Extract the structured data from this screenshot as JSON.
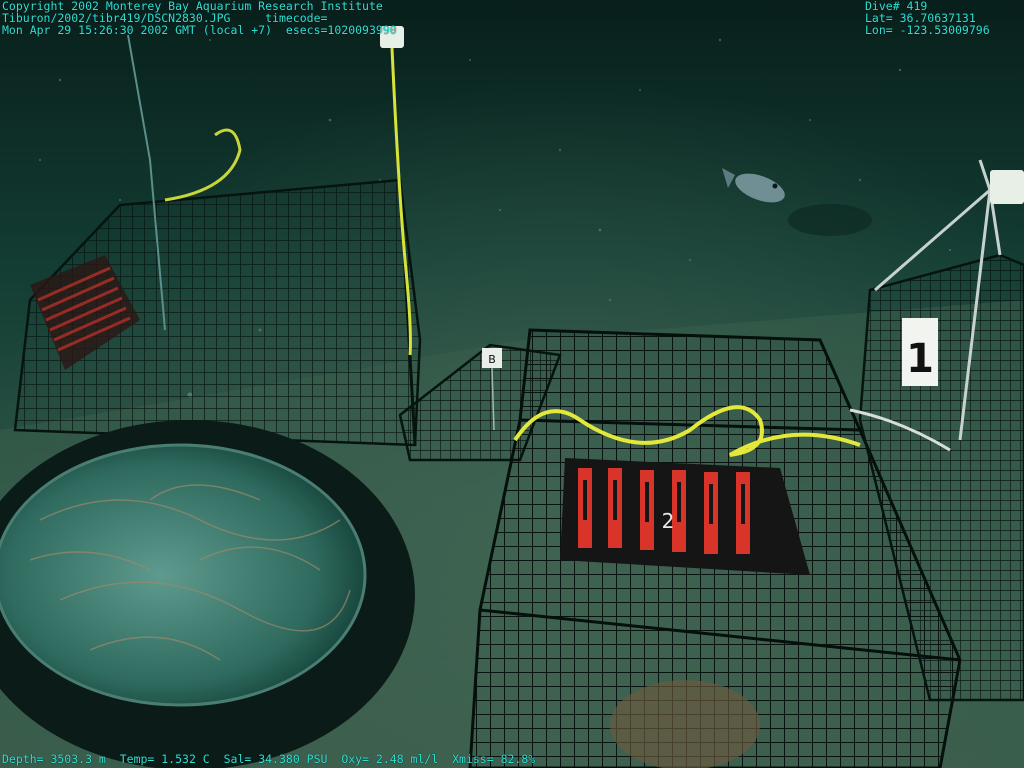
{
  "header": {
    "copyright": "Copyright 2002 Monterey Bay Aquarium Research Institute",
    "file_path": "Tiburon/2002/tibr419/DSCN2830.JPG",
    "timecode_label": "timecode=",
    "datetime": "Mon Apr 29 15:26:30 2002 GMT (local +7)",
    "esecs": "esecs=1020093990"
  },
  "dive_info": {
    "dive": "Dive# 419",
    "lat": "Lat= 36.70637131",
    "lon": "Lon= -123.53009796"
  },
  "sensors": {
    "depth": "Depth= 3503.3 m",
    "temp": "Temp= 1.532 C",
    "sal": "Sal= 34.380 PSU",
    "oxy": "Oxy= 2.48 ml/l",
    "xmiss": "Xmiss= 82.8%"
  },
  "scene_labels": {
    "tag_b": "B",
    "tag_1": "1",
    "crate_label": "2"
  },
  "colors": {
    "overlay_text": "#2fe0d0",
    "water": "#0f3a30",
    "sediment": "#3b5e4c",
    "rope": "#d7e23a",
    "red_crate": "#d8342a"
  }
}
